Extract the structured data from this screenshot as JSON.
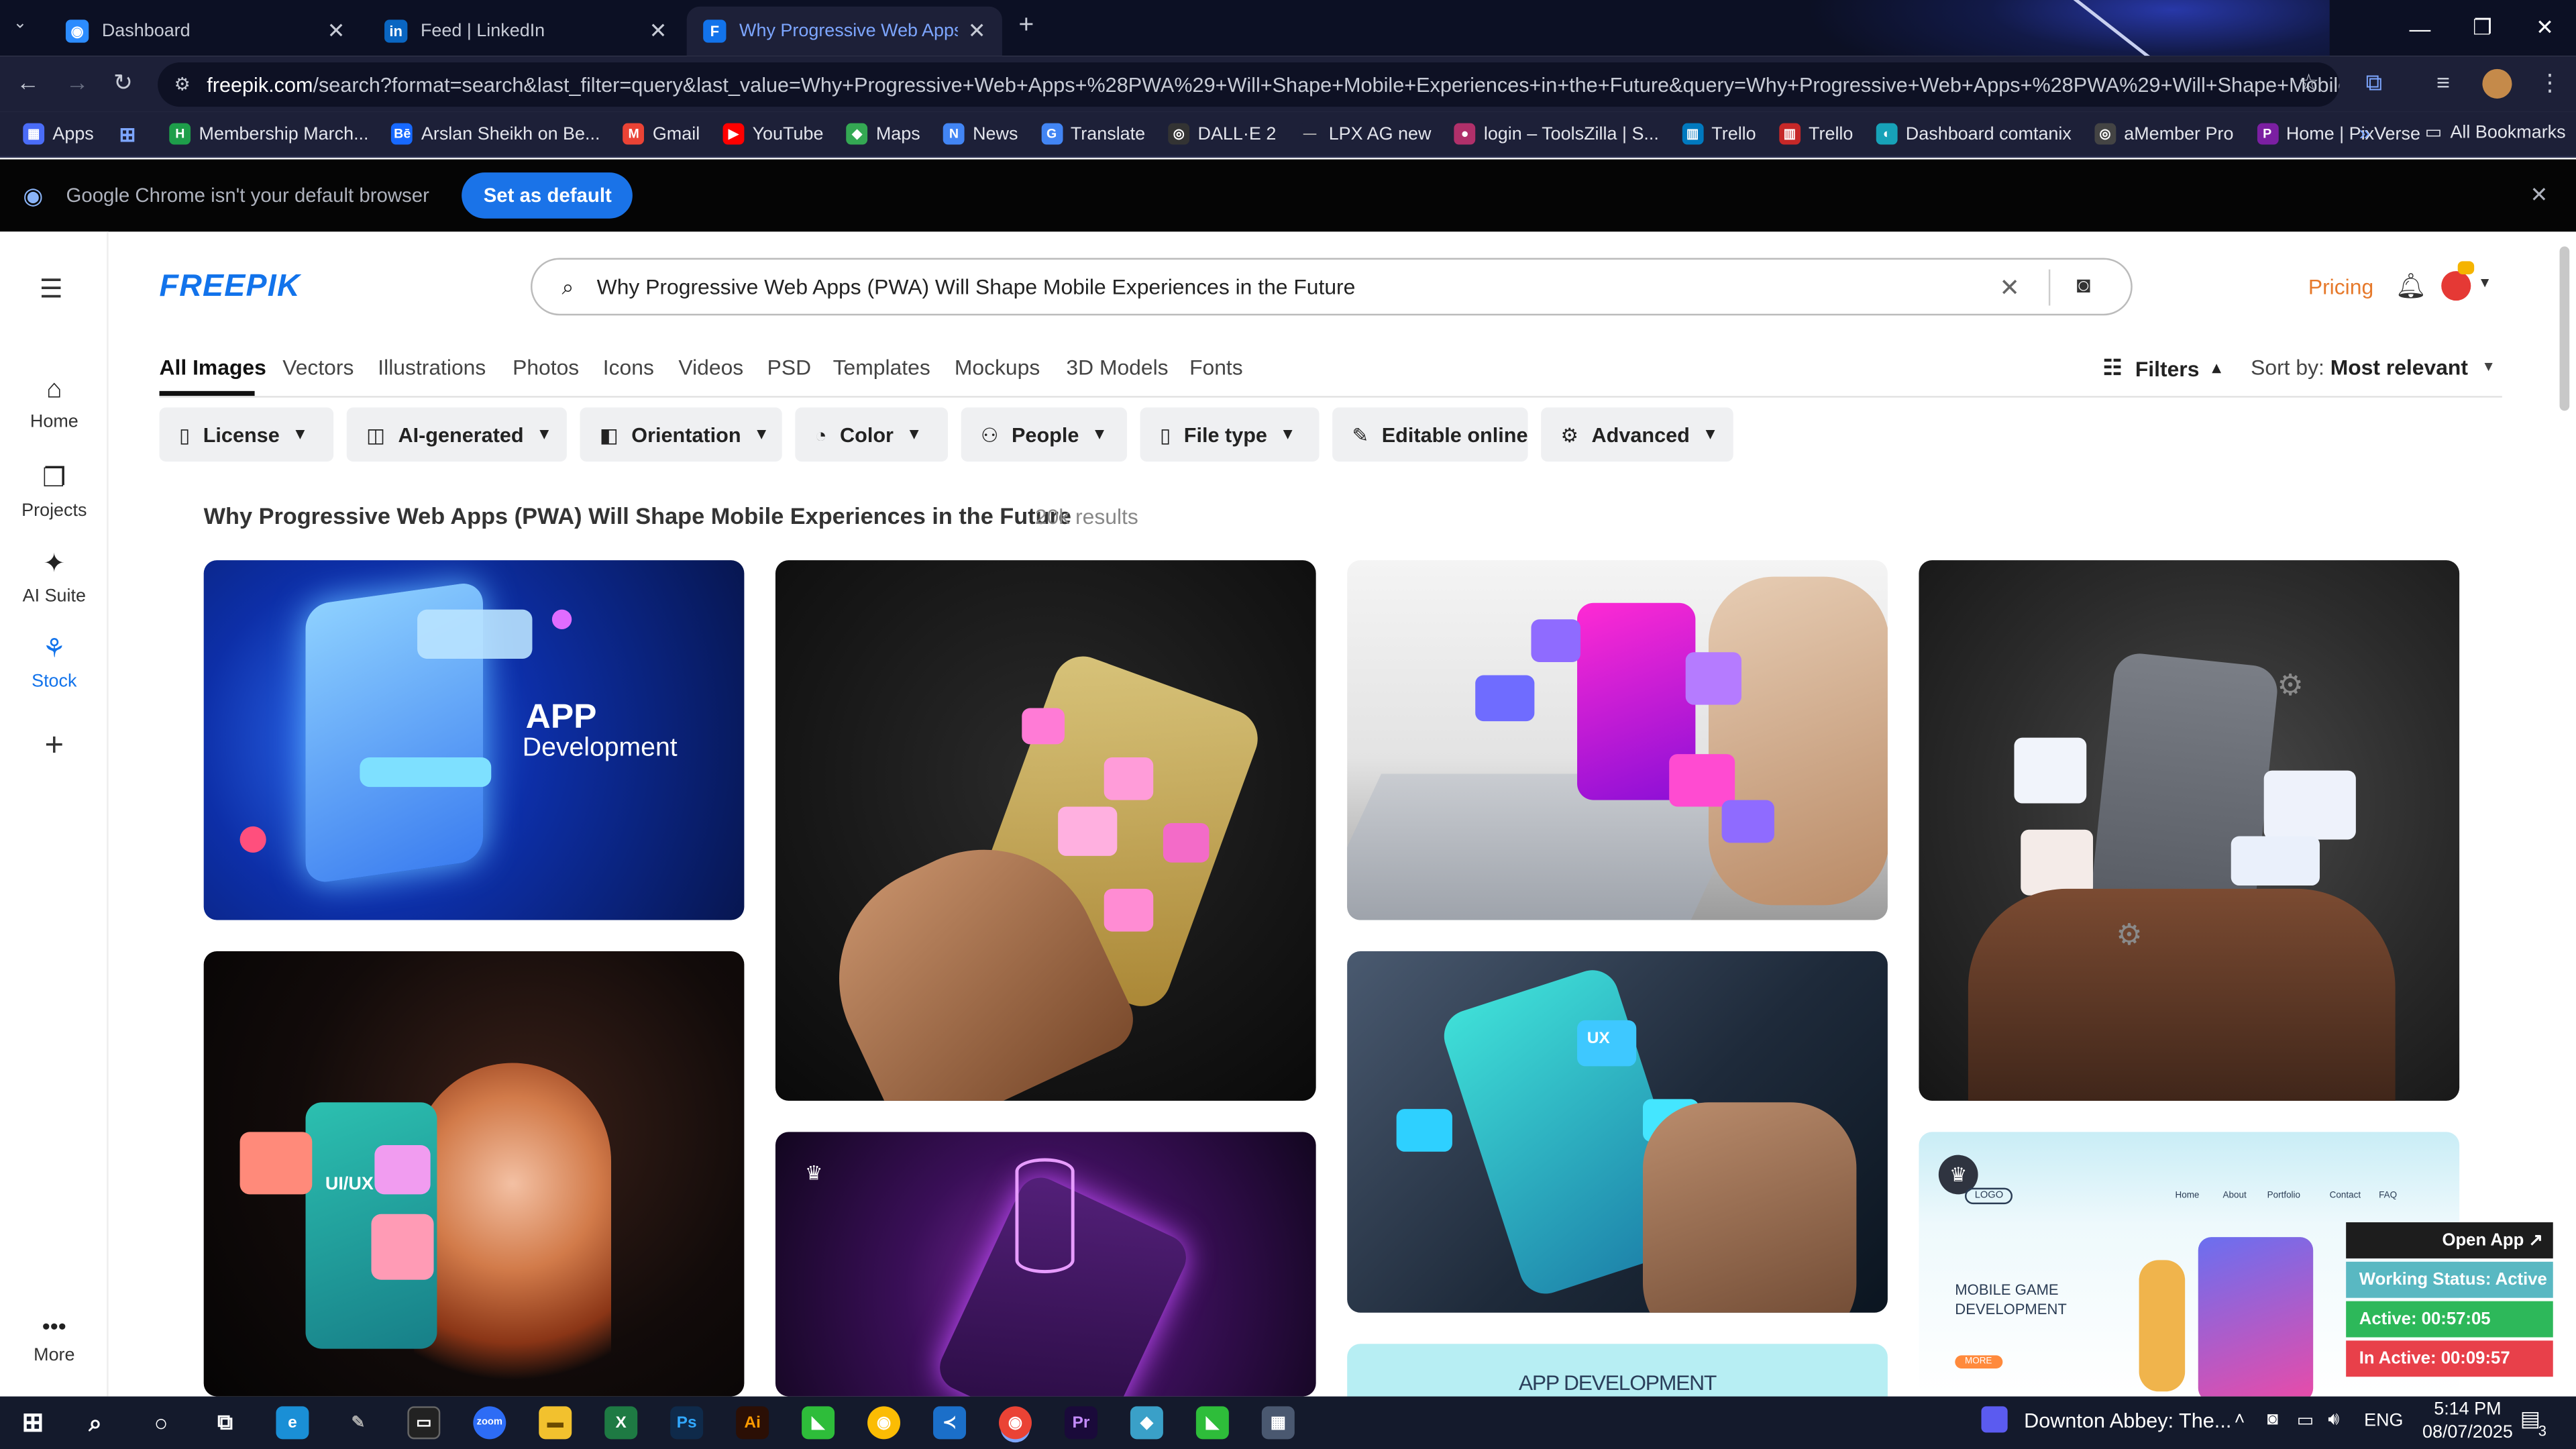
{
  "browser": {
    "tabs": [
      {
        "title": "Dashboard",
        "icon": "globe-icon"
      },
      {
        "title": "Feed | LinkedIn",
        "icon": "linkedin-icon"
      },
      {
        "title": "Why Progressive Web Apps (P",
        "icon": "freepik-icon"
      }
    ],
    "url_host": "freepik.com",
    "url_rest": "/search?format=search&last_filter=query&last_value=Why+Progressive+Web+Apps+%28PWA%29+Will+Shape+Mobile+Experiences+in+the+Future&query=Why+Progressive+Web+Apps+%28PWA%29+Will+Shape+Mobile+Experien...",
    "bookmarks": [
      "Apps",
      "Membership March...",
      "Arslan Sheikh on Be...",
      "Gmail",
      "YouTube",
      "Maps",
      "News",
      "Translate",
      "DALL·E 2",
      "LPX AG new",
      "login – ToolsZilla | S...",
      "Trello",
      "Trello",
      "Dashboard comtanix",
      "aMember Pro",
      "Home | PixVerse"
    ],
    "all_bookmarks": "All Bookmarks",
    "infobar_text": "Google Chrome isn't your default browser",
    "set_default": "Set as default"
  },
  "sidebar": {
    "items": [
      {
        "label": "Home",
        "icon": "home-icon"
      },
      {
        "label": "Projects",
        "icon": "projects-icon"
      },
      {
        "label": "AI Suite",
        "icon": "ai-suite-icon"
      },
      {
        "label": "Stock",
        "icon": "stock-icon"
      }
    ],
    "more": "More"
  },
  "header": {
    "logo": "FREEPIK",
    "search_query": "Why Progressive Web Apps (PWA) Will Shape Mobile Experiences in the Future",
    "pricing": "Pricing"
  },
  "type_tabs": [
    "All Images",
    "Vectors",
    "Illustrations",
    "Photos",
    "Icons",
    "Videos",
    "PSD",
    "Templates",
    "Mockups",
    "3D Models",
    "Fonts"
  ],
  "filters_label": "Filters",
  "sort_label": "Sort by:",
  "sort_value": "Most relevant",
  "filters": [
    {
      "label": "License",
      "icon": "license-icon"
    },
    {
      "label": "AI-generated",
      "icon": "ai-icon"
    },
    {
      "label": "Orientation",
      "icon": "orientation-icon"
    },
    {
      "label": "Color",
      "icon": "palette-icon"
    },
    {
      "label": "People",
      "icon": "people-icon"
    },
    {
      "label": "File type",
      "icon": "file-icon"
    },
    {
      "label": "Editable online",
      "icon": "pen-icon"
    },
    {
      "label": "Advanced",
      "icon": "settings-icon"
    }
  ],
  "results": {
    "title": "Why Progressive Web Apps (PWA) Will Shape Mobile Experiences in the Future",
    "count": "20k results"
  },
  "cards": {
    "app_dev_title": "APP",
    "app_dev_sub": "Development",
    "uiux": "UI/UX",
    "ux": "UX",
    "app_development": "APP DEVELOPMENT",
    "mobile_game": "MOBILE GAME DEVELOPMENT",
    "logo": "LOGO",
    "nav": [
      "Home",
      "About",
      "Portfolio",
      "Contact",
      "FAQ"
    ],
    "more": "MORE"
  },
  "overlay": {
    "open_app": "Open App ↗",
    "working": "Working Status: Active",
    "active": "Active: 00:57:05",
    "inactive": "In Active: 00:09:57"
  },
  "taskbar": {
    "media": "Downton Abbey: The...",
    "lang": "ENG",
    "time": "5:14 PM",
    "date": "08/07/2025",
    "notifications": "3"
  }
}
